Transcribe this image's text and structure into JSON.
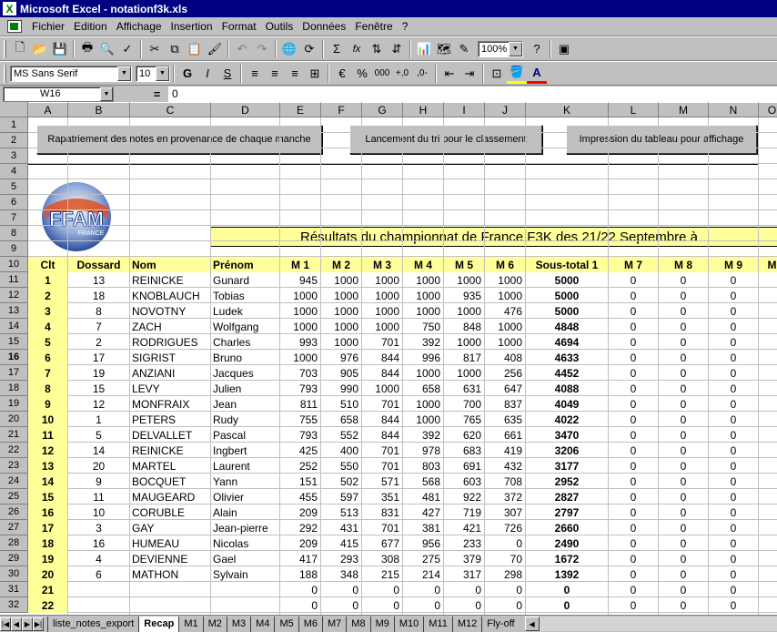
{
  "window": {
    "title": "Microsoft Excel - notationf3k.xls"
  },
  "menu": [
    "Fichier",
    "Edition",
    "Affichage",
    "Insertion",
    "Format",
    "Outils",
    "Données",
    "Fenêtre",
    "?"
  ],
  "toolbar": {
    "zoom": "100%",
    "font_name": "MS Sans Serif",
    "font_size": "10",
    "sum": "Σ",
    "fx": "fx",
    "bold": "G",
    "italic": "I",
    "underline": "S",
    "percent": "%",
    "thousands": "000"
  },
  "formula": {
    "cell_ref": "W16",
    "equals": "=",
    "value": "0"
  },
  "columns": [
    {
      "label": "A",
      "w": 44
    },
    {
      "label": "B",
      "w": 68
    },
    {
      "label": "C",
      "w": 89
    },
    {
      "label": "D",
      "w": 76
    },
    {
      "label": "E",
      "w": 45
    },
    {
      "label": "F",
      "w": 45
    },
    {
      "label": "G",
      "w": 45
    },
    {
      "label": "H",
      "w": 45
    },
    {
      "label": "I",
      "w": 45
    },
    {
      "label": "J",
      "w": 45
    },
    {
      "label": "K",
      "w": 91
    },
    {
      "label": "L",
      "w": 55
    },
    {
      "label": "M",
      "w": 55
    },
    {
      "label": "N",
      "w": 55
    },
    {
      "label": "O",
      "w": 30
    }
  ],
  "rows": [
    "1",
    "2",
    "3",
    "4",
    "5",
    "6",
    "7",
    "8",
    "9",
    "10",
    "11",
    "12",
    "13",
    "14",
    "15",
    "16",
    "17",
    "18",
    "19",
    "20",
    "21",
    "22",
    "23",
    "24",
    "25",
    "26",
    "27",
    "28",
    "29",
    "30",
    "31",
    "32"
  ],
  "buttons": {
    "rapatriement": "Rapatriement des notes en provenance de chaque manche",
    "tri": "Lancement du tri pour le classement",
    "impression": "Impression du tableau pour affichage"
  },
  "logo": {
    "text": "FFAM",
    "subtext": "FRANCE"
  },
  "banner": "Résultats du championnat de France F3K des 21/22 Septembre à",
  "header": [
    "Clt",
    "Dossard",
    "Nom",
    "Prénom",
    "M 1",
    "M 2",
    "M 3",
    "M 4",
    "M 5",
    "M 6",
    "Sous-total 1",
    "M 7",
    "M 8",
    "M 9",
    "M"
  ],
  "results": [
    [
      "1",
      "13",
      "REINICKE",
      "Gunard",
      "945",
      "1000",
      "1000",
      "1000",
      "1000",
      "1000",
      "5000",
      "0",
      "0",
      "0"
    ],
    [
      "2",
      "18",
      "KNOBLAUCH",
      "Tobias",
      "1000",
      "1000",
      "1000",
      "1000",
      "935",
      "1000",
      "5000",
      "0",
      "0",
      "0"
    ],
    [
      "3",
      "8",
      "NOVOTNY",
      "Ludek",
      "1000",
      "1000",
      "1000",
      "1000",
      "1000",
      "476",
      "5000",
      "0",
      "0",
      "0"
    ],
    [
      "4",
      "7",
      "ZACH",
      "Wolfgang",
      "1000",
      "1000",
      "1000",
      "750",
      "848",
      "1000",
      "4848",
      "0",
      "0",
      "0"
    ],
    [
      "5",
      "2",
      "RODRIGUES",
      "Charles",
      "993",
      "1000",
      "701",
      "392",
      "1000",
      "1000",
      "4694",
      "0",
      "0",
      "0"
    ],
    [
      "6",
      "17",
      "SIGRIST",
      "Bruno",
      "1000",
      "976",
      "844",
      "996",
      "817",
      "408",
      "4633",
      "0",
      "0",
      "0"
    ],
    [
      "7",
      "19",
      "ANZIANI",
      "Jacques",
      "703",
      "905",
      "844",
      "1000",
      "1000",
      "256",
      "4452",
      "0",
      "0",
      "0"
    ],
    [
      "8",
      "15",
      "LEVY",
      "Julien",
      "793",
      "990",
      "1000",
      "658",
      "631",
      "647",
      "4088",
      "0",
      "0",
      "0"
    ],
    [
      "9",
      "12",
      "MONFRAIX",
      "Jean",
      "811",
      "510",
      "701",
      "1000",
      "700",
      "837",
      "4049",
      "0",
      "0",
      "0"
    ],
    [
      "10",
      "1",
      "PETERS",
      "Rudy",
      "755",
      "658",
      "844",
      "1000",
      "765",
      "635",
      "4022",
      "0",
      "0",
      "0"
    ],
    [
      "11",
      "5",
      "DELVALLET",
      "Pascal",
      "793",
      "552",
      "844",
      "392",
      "620",
      "661",
      "3470",
      "0",
      "0",
      "0"
    ],
    [
      "12",
      "14",
      "REINICKE",
      "Ingbert",
      "425",
      "400",
      "701",
      "978",
      "683",
      "419",
      "3206",
      "0",
      "0",
      "0"
    ],
    [
      "13",
      "20",
      "MARTEL",
      "Laurent",
      "252",
      "550",
      "701",
      "803",
      "691",
      "432",
      "3177",
      "0",
      "0",
      "0"
    ],
    [
      "14",
      "9",
      "BOCQUET",
      "Yann",
      "151",
      "502",
      "571",
      "568",
      "603",
      "708",
      "2952",
      "0",
      "0",
      "0"
    ],
    [
      "15",
      "11",
      "MAUGEARD",
      "Olivier",
      "455",
      "597",
      "351",
      "481",
      "922",
      "372",
      "2827",
      "0",
      "0",
      "0"
    ],
    [
      "16",
      "10",
      "CORUBLE",
      "Alain",
      "209",
      "513",
      "831",
      "427",
      "719",
      "307",
      "2797",
      "0",
      "0",
      "0"
    ],
    [
      "17",
      "3",
      "GAY",
      "Jean-pierre",
      "292",
      "431",
      "701",
      "381",
      "421",
      "726",
      "2660",
      "0",
      "0",
      "0"
    ],
    [
      "18",
      "16",
      "HUMEAU",
      "Nicolas",
      "209",
      "415",
      "677",
      "956",
      "233",
      "0",
      "2490",
      "0",
      "0",
      "0"
    ],
    [
      "19",
      "4",
      "DEVIENNE",
      "Gael",
      "417",
      "293",
      "308",
      "275",
      "379",
      "70",
      "1672",
      "0",
      "0",
      "0"
    ],
    [
      "20",
      "6",
      "MATHON",
      "Sylvain",
      "188",
      "348",
      "215",
      "214",
      "317",
      "298",
      "1392",
      "0",
      "0",
      "0"
    ],
    [
      "21",
      "",
      "",
      "",
      "0",
      "0",
      "0",
      "0",
      "0",
      "0",
      "0",
      "0",
      "0",
      "0"
    ],
    [
      "22",
      "",
      "",
      "",
      "0",
      "0",
      "0",
      "0",
      "0",
      "0",
      "0",
      "0",
      "0",
      "0"
    ]
  ],
  "tabs": [
    "liste_notes_export",
    "Recap",
    "M1",
    "M2",
    "M3",
    "M4",
    "M5",
    "M6",
    "M7",
    "M8",
    "M9",
    "M10",
    "M11",
    "M12",
    "Fly-off"
  ],
  "active_tab": "Recap",
  "colors": {
    "title_bar": "#000080",
    "highlight": "#ffff99",
    "chrome": "#c0c0c0"
  }
}
